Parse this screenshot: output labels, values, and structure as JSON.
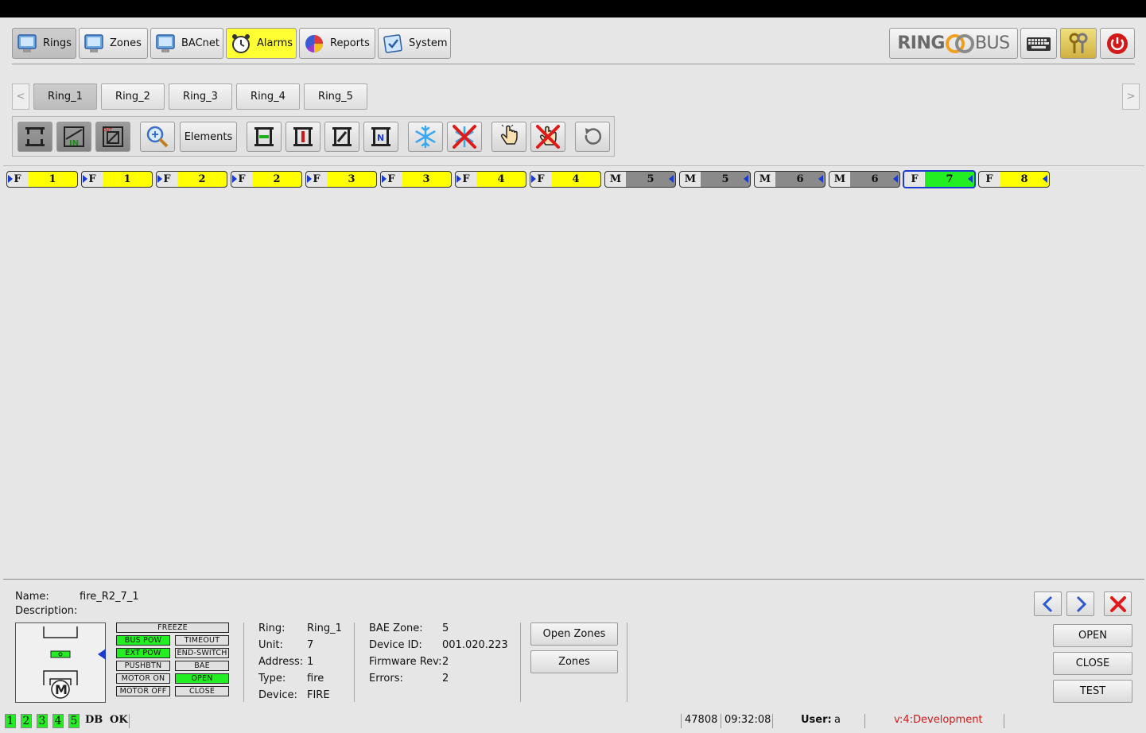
{
  "nav": [
    {
      "label": "Rings",
      "state": "active"
    },
    {
      "label": "Zones",
      "state": ""
    },
    {
      "label": "BACnet",
      "state": ""
    },
    {
      "label": "Alarms",
      "state": "alarm"
    },
    {
      "label": "Reports",
      "state": ""
    },
    {
      "label": "System",
      "state": ""
    }
  ],
  "brand": {
    "ring": "RING",
    "bus": "BUS"
  },
  "ring_tabs": [
    "Ring_1",
    "Ring_2",
    "Ring_3",
    "Ring_4",
    "Ring_5"
  ],
  "tab_prev": "<",
  "tab_next": ">",
  "toolbar": {
    "elements_label": "Elements"
  },
  "elements": [
    {
      "type": "F",
      "num": "1",
      "color": "#ffff00",
      "marker": "left"
    },
    {
      "type": "F",
      "num": "1",
      "color": "#ffff00",
      "marker": "left"
    },
    {
      "type": "F",
      "num": "2",
      "color": "#ffff00",
      "marker": "left"
    },
    {
      "type": "F",
      "num": "2",
      "color": "#ffff00",
      "marker": "left"
    },
    {
      "type": "F",
      "num": "3",
      "color": "#ffff00",
      "marker": "left"
    },
    {
      "type": "F",
      "num": "3",
      "color": "#ffff00",
      "marker": "left"
    },
    {
      "type": "F",
      "num": "4",
      "color": "#ffff00",
      "marker": "left"
    },
    {
      "type": "F",
      "num": "4",
      "color": "#ffff00",
      "marker": "left"
    },
    {
      "type": "M",
      "num": "5",
      "color": "#8a8a8a",
      "marker": "right"
    },
    {
      "type": "M",
      "num": "5",
      "color": "#8a8a8a",
      "marker": "right"
    },
    {
      "type": "M",
      "num": "6",
      "color": "#8a8a8a",
      "marker": "right"
    },
    {
      "type": "M",
      "num": "6",
      "color": "#8a8a8a",
      "marker": "right"
    },
    {
      "type": "F",
      "num": "7",
      "color": "#22ee22",
      "marker": "right",
      "selected": true
    },
    {
      "type": "F",
      "num": "8",
      "color": "#ffff00",
      "marker": "right"
    }
  ],
  "detail": {
    "name_label": "Name:",
    "name": "fire_R2_7_1",
    "desc_label": "Description:",
    "desc": "",
    "status": [
      {
        "label": "FREEZE",
        "on": false
      },
      {
        "label": "BUS POW",
        "on": true
      },
      {
        "label": "TIMEOUT",
        "on": false
      },
      {
        "label": "EXT POW",
        "on": true
      },
      {
        "label": "END-SWITCH",
        "on": false
      },
      {
        "label": "PUSHBTN",
        "on": false
      },
      {
        "label": "BAE",
        "on": false
      },
      {
        "label": "MOTOR ON",
        "on": false
      },
      {
        "label": "OPEN",
        "on": true
      },
      {
        "label": "MOTOR OFF",
        "on": false
      },
      {
        "label": "CLOSE",
        "on": false
      }
    ],
    "info1": [
      {
        "k": "Ring:",
        "v": "Ring_1"
      },
      {
        "k": "Unit:",
        "v": "7"
      },
      {
        "k": "Address:",
        "v": "1"
      },
      {
        "k": "Type:",
        "v": "fire"
      },
      {
        "k": "Device:",
        "v": "FIRE"
      }
    ],
    "info2": [
      {
        "k": "BAE Zone:",
        "v": "5"
      },
      {
        "k": "Device ID:",
        "v": "001.020.223"
      },
      {
        "k": "Firmware Rev:",
        "v": "2"
      },
      {
        "k": "Errors:",
        "v": "2"
      }
    ],
    "open_zones": "Open Zones",
    "zones": "Zones",
    "open": "OPEN",
    "close": "CLOSE",
    "test": "TEST"
  },
  "statusbar": {
    "rings": [
      "1",
      "2",
      "3",
      "4",
      "5"
    ],
    "db": "DB",
    "ok": "OK",
    "counter": "47808",
    "time": "09:32:08",
    "user_label": "User:",
    "user": "a",
    "version": "v:4:Development"
  }
}
